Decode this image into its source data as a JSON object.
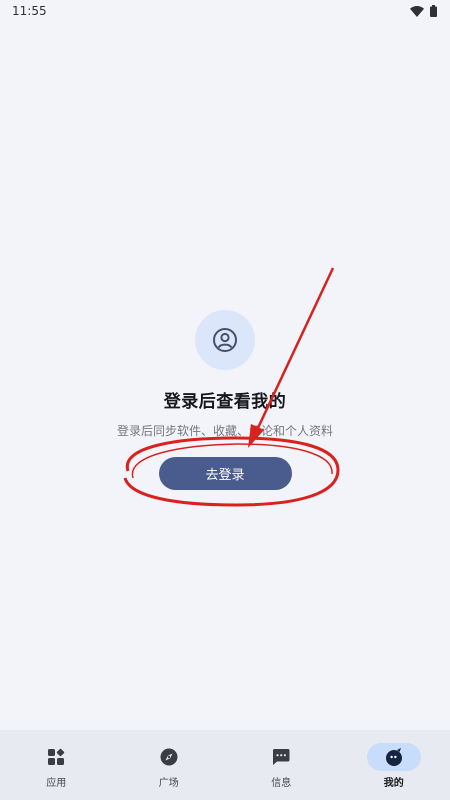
{
  "status_bar": {
    "time": "11:55",
    "wifi_icon": "wifi-icon",
    "battery_icon": "battery-icon"
  },
  "main": {
    "avatar_icon": "account-circle-icon",
    "title": "登录后查看我的",
    "subtitle": "登录后同步软件、收藏、评论和个人资料",
    "login_button": "去登录"
  },
  "annotation": {
    "color": "#d9211e",
    "arrow_icon": "red-arrow-icon",
    "ellipse_icon": "red-ellipse-icon"
  },
  "bottom_nav": {
    "items": [
      {
        "label": "应用",
        "icon": "apps-grid-icon",
        "active": false
      },
      {
        "label": "广场",
        "icon": "compass-icon",
        "active": false
      },
      {
        "label": "信息",
        "icon": "message-icon",
        "active": false
      },
      {
        "label": "我的",
        "icon": "bird-avatar-icon",
        "active": true
      }
    ]
  },
  "colors": {
    "accent": "#4a5c8e",
    "background": "#f3f4fa",
    "nav_active": "#c8dcfb"
  }
}
